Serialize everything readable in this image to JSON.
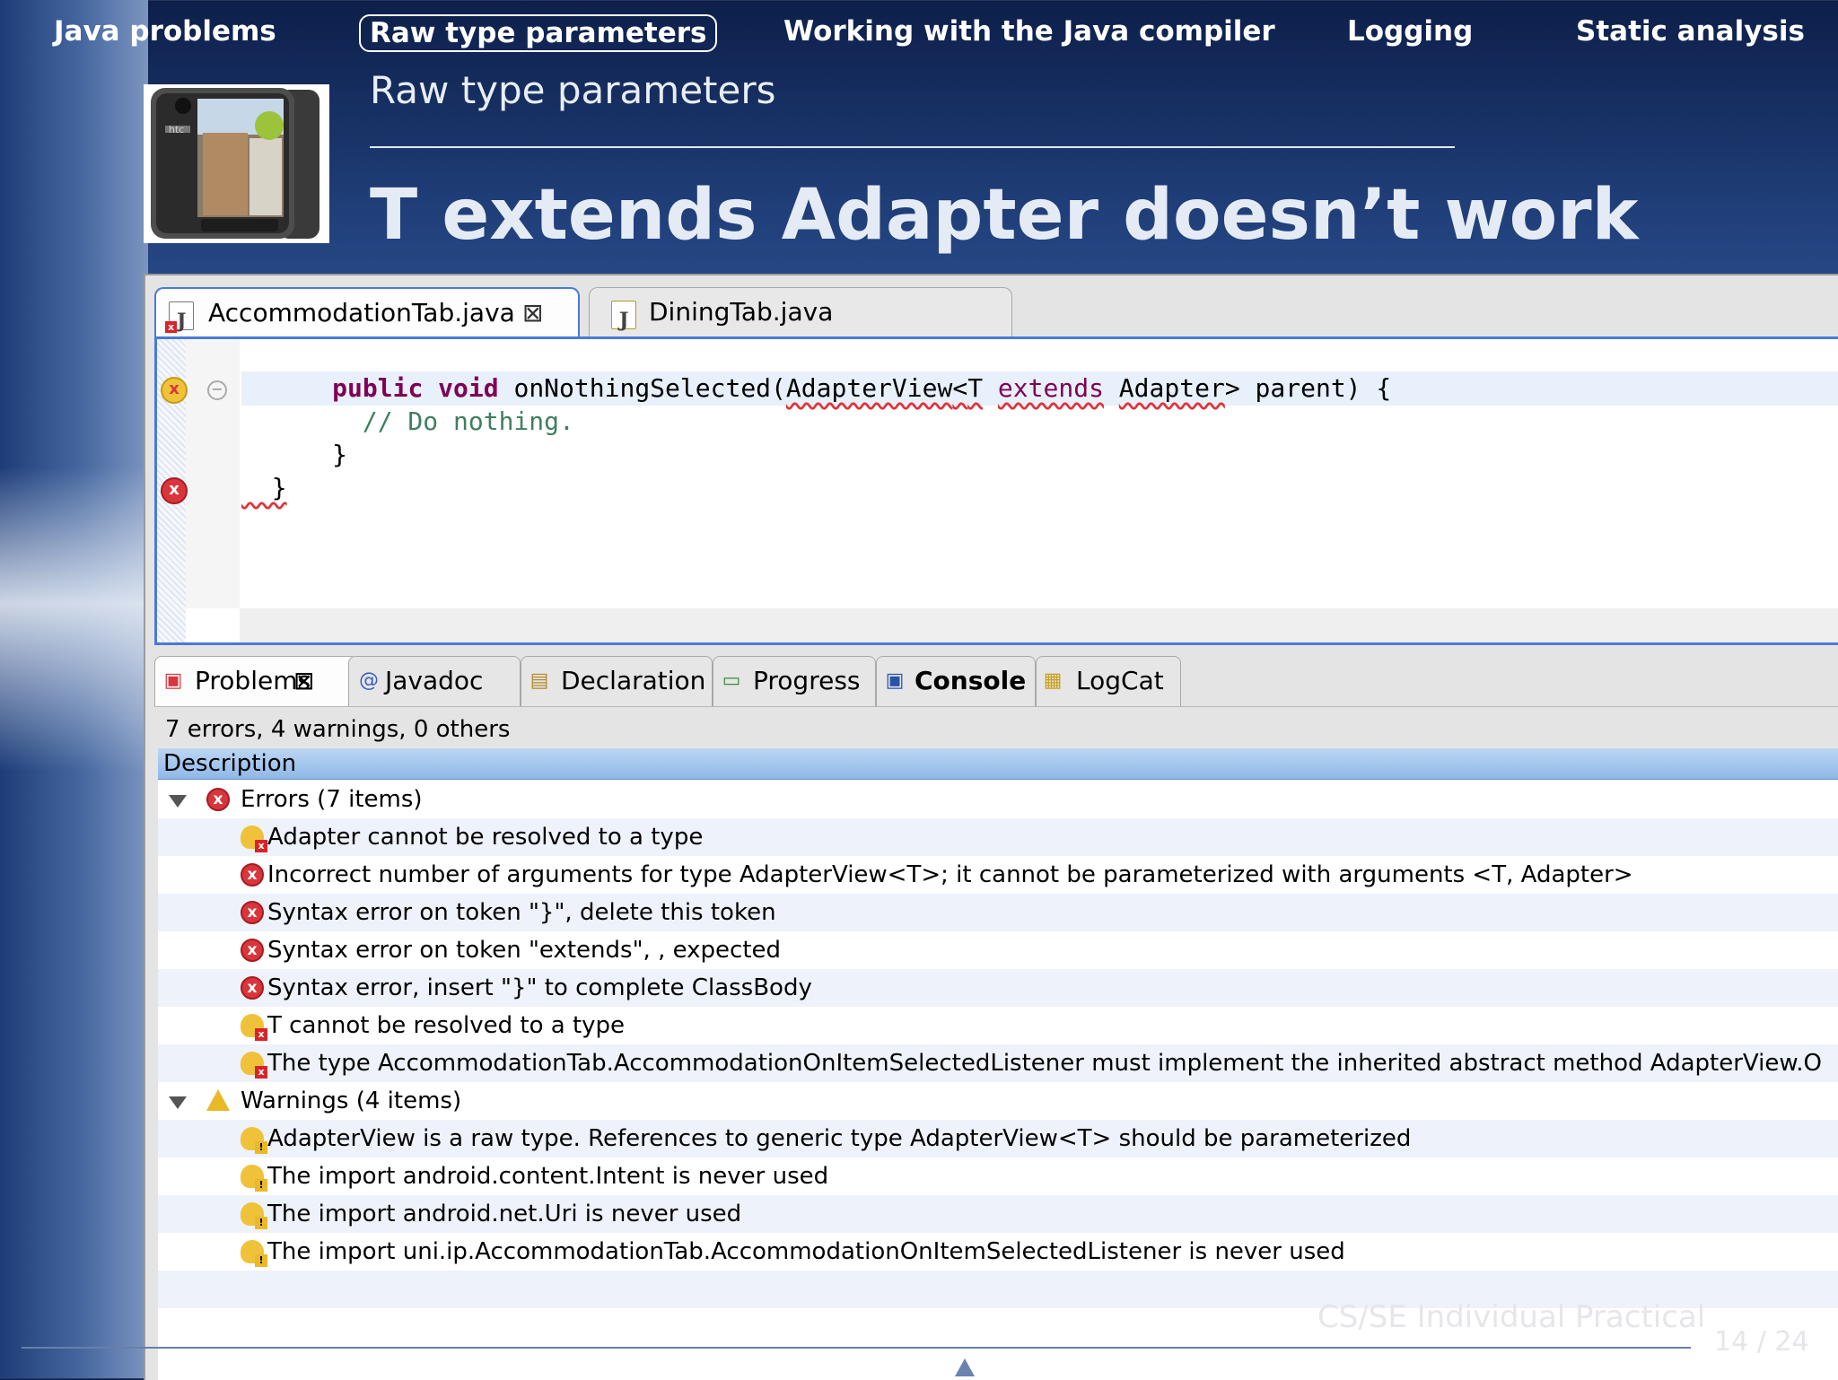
{
  "nav": {
    "items": [
      "Java problems",
      "Raw type parameters",
      "Working with the Java compiler",
      "Logging",
      "Static analysis"
    ],
    "active_index": 1
  },
  "header": {
    "subtitle": "Raw type parameters",
    "title": "T extends Adapter doesn’t work",
    "image_alt": "htc"
  },
  "editor": {
    "tabs": [
      {
        "label": "AccommodationTab.java",
        "close": "⊠",
        "has_error": true,
        "active": true
      },
      {
        "label": "DiningTab.java",
        "has_error": false,
        "active": false
      }
    ],
    "code_lines": [
      {
        "indent": "      ",
        "kw1": "public",
        "kw2": "void",
        "pre": " onNothingSelected(",
        "e1": "AdapterView",
        "lt": "<",
        "e2": "T",
        "sp": " ",
        "e3": "extends",
        "sp2": " ",
        "e4": "Adapter",
        "post": "> parent) {"
      },
      {
        "text": "        // Do nothing."
      },
      {
        "text": "      }"
      },
      {
        "text": "  }"
      }
    ]
  },
  "problems": {
    "tabs": [
      {
        "label": "Problems",
        "close": "⊠",
        "icon": "problems-icon"
      },
      {
        "label": "Javadoc",
        "icon": "at-icon"
      },
      {
        "label": "Declaration",
        "icon": "declaration-icon"
      },
      {
        "label": "Progress",
        "icon": "progress-icon"
      },
      {
        "label": "Console",
        "icon": "console-icon"
      },
      {
        "label": "LogCat",
        "icon": "logcat-icon"
      }
    ],
    "summary": "7 errors, 4 warnings, 0 others",
    "column_header": "Description",
    "errors_group": "Errors (7 items)",
    "errors": [
      {
        "icon": "bulb-error-icon",
        "text": "Adapter cannot be resolved to a type"
      },
      {
        "icon": "error-icon",
        "text": "Incorrect number of arguments for type AdapterView<T>; it cannot be parameterized with arguments <T, Adapter>"
      },
      {
        "icon": "error-icon",
        "text": "Syntax error on token \"}\", delete this token"
      },
      {
        "icon": "error-icon",
        "text": "Syntax error on token \"extends\", , expected"
      },
      {
        "icon": "error-icon",
        "text": "Syntax error, insert \"}\" to complete ClassBody"
      },
      {
        "icon": "bulb-error-icon",
        "text": "T cannot be resolved to a type"
      },
      {
        "icon": "bulb-error-icon",
        "text": "The type AccommodationTab.AccommodationOnItemSelectedListener must implement the inherited abstract method AdapterView.O"
      }
    ],
    "warnings_group": "Warnings (4 items)",
    "warnings": [
      {
        "icon": "bulb-warning-icon",
        "text": "AdapterView is a raw type. References to generic type AdapterView<T> should be parameterized"
      },
      {
        "icon": "bulb-warning-icon",
        "text": "The import android.content.Intent is never used"
      },
      {
        "icon": "bulb-warning-icon",
        "text": "The import android.net.Uri is never used"
      },
      {
        "icon": "bulb-warning-icon",
        "text": "The import uni.ip.AccommodationTab.AccommodationOnItemSelectedListener is never used"
      }
    ]
  },
  "footer": {
    "course": "CS/SE Individual Practical",
    "page": "14 / 24"
  }
}
